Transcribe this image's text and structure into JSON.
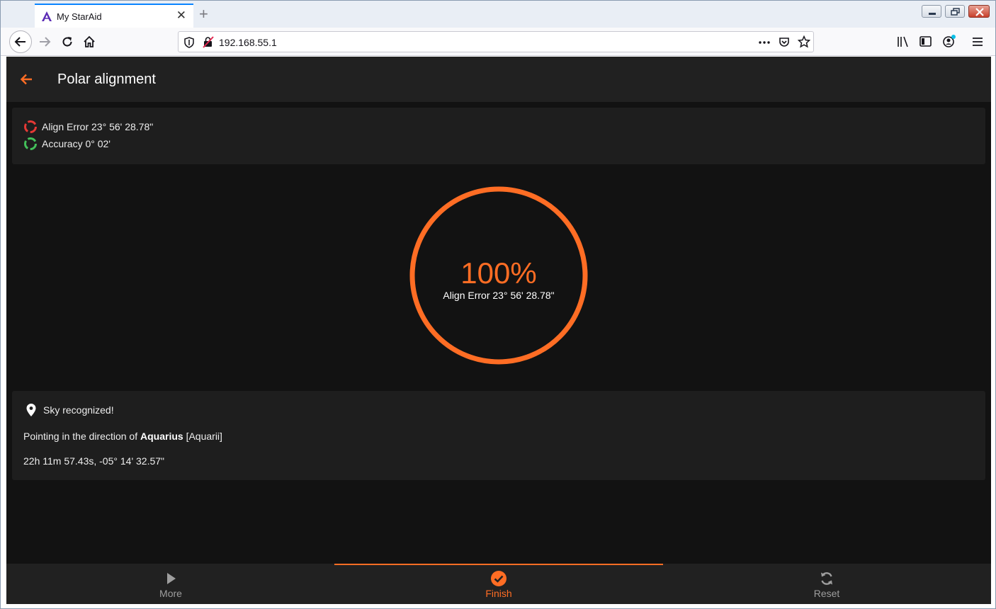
{
  "browser": {
    "tab_title": "My StarAid",
    "url": "192.168.55.1"
  },
  "colors": {
    "accent": "#ff6d24",
    "error": "#e53935",
    "success": "#43c05a",
    "app_bg": "#121212",
    "card_bg": "#1e1e1e"
  },
  "app": {
    "title": "Polar alignment"
  },
  "status": {
    "align_error": "Align Error 23° 56' 28.78\"",
    "accuracy": "Accuracy 0° 02'"
  },
  "gauge": {
    "percent_label": "100%",
    "percent_value": 100,
    "subtitle": "Align Error 23° 56' 28.78\""
  },
  "sky": {
    "heading": "Sky recognized!",
    "pointing_prefix": "Pointing in the direction of",
    "constellation": "Aquarius",
    "constellation_latin": "[Aquarii]",
    "coordinates": "22h 11m 57.43s, -05° 14' 32.57\""
  },
  "bottom_nav": {
    "items": [
      {
        "label": "More",
        "icon": "play-icon",
        "active": false
      },
      {
        "label": "Finish",
        "icon": "check-circle-icon",
        "active": true
      },
      {
        "label": "Reset",
        "icon": "refresh-icon",
        "active": false
      }
    ]
  }
}
